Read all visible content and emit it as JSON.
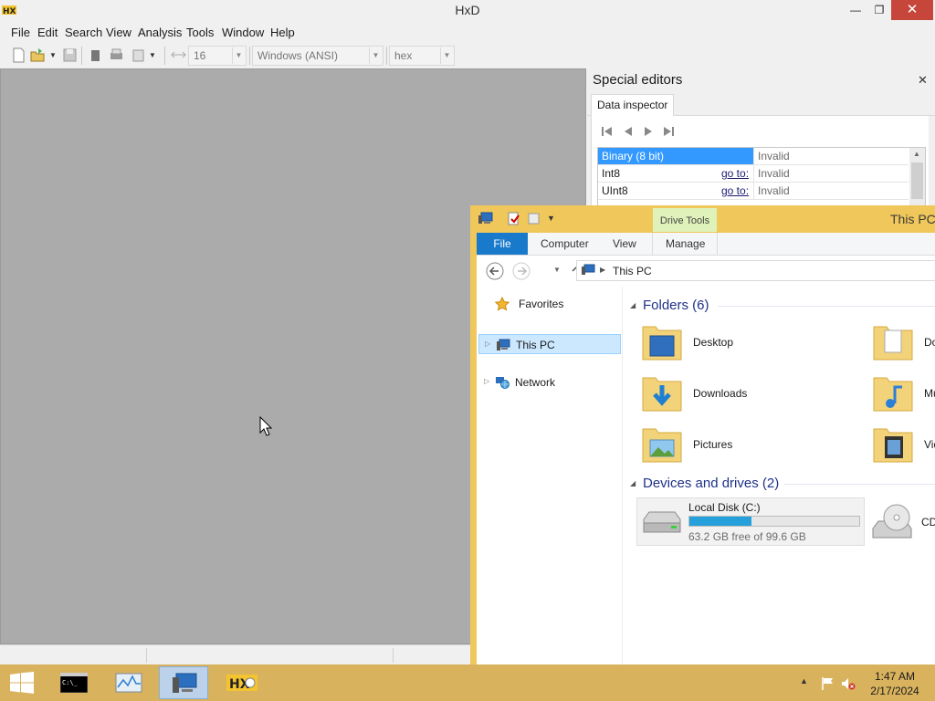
{
  "hxd": {
    "title": "HxD",
    "window_buttons": {
      "minimize": "—",
      "maximize": "❐",
      "close": "✕"
    },
    "menu": [
      "File",
      "Edit",
      "Search",
      "View",
      "Analysis",
      "Tools",
      "Window",
      "Help"
    ],
    "toolbar": {
      "bytes_per_row": "16",
      "charset": "Windows (ANSI)",
      "offset_base": "hex"
    },
    "special_editors": {
      "title": "Special editors",
      "close": "✕",
      "tab": "Data inspector",
      "rows": [
        {
          "name": "Binary (8 bit)",
          "goto": "",
          "value": "Invalid",
          "selected": true
        },
        {
          "name": "Int8",
          "goto": "go to:",
          "value": "Invalid",
          "selected": false
        },
        {
          "name": "UInt8",
          "goto": "go to:",
          "value": "Invalid",
          "selected": false
        }
      ]
    }
  },
  "explorer": {
    "title": "This PC",
    "contextual_tab": "Drive Tools",
    "ribbon_tabs": {
      "file": "File",
      "computer": "Computer",
      "view": "View",
      "manage": "Manage"
    },
    "address": "This PC",
    "nav": {
      "favorites": "Favorites",
      "this_pc": "This PC",
      "network": "Network"
    },
    "folders_header": "Folders (6)",
    "folders": [
      {
        "name": "Desktop",
        "icon": "desktop-folder-icon"
      },
      {
        "name": "Do",
        "icon": "documents-folder-icon"
      },
      {
        "name": "Downloads",
        "icon": "downloads-folder-icon"
      },
      {
        "name": "Mu",
        "icon": "music-folder-icon"
      },
      {
        "name": "Pictures",
        "icon": "pictures-folder-icon"
      },
      {
        "name": "Vid",
        "icon": "videos-folder-icon"
      }
    ],
    "devices_header": "Devices and drives (2)",
    "drives": {
      "local_name": "Local Disk (C:)",
      "local_free": "63.2 GB free of 99.6 GB",
      "local_used_fraction": 0.365,
      "cd_name": "CD"
    }
  },
  "taskbar": {
    "time": "1:47 AM",
    "date": "2/17/2024",
    "apps": [
      "cmd-icon",
      "performance-monitor-icon",
      "file-explorer-icon",
      "hxd-icon"
    ]
  }
}
